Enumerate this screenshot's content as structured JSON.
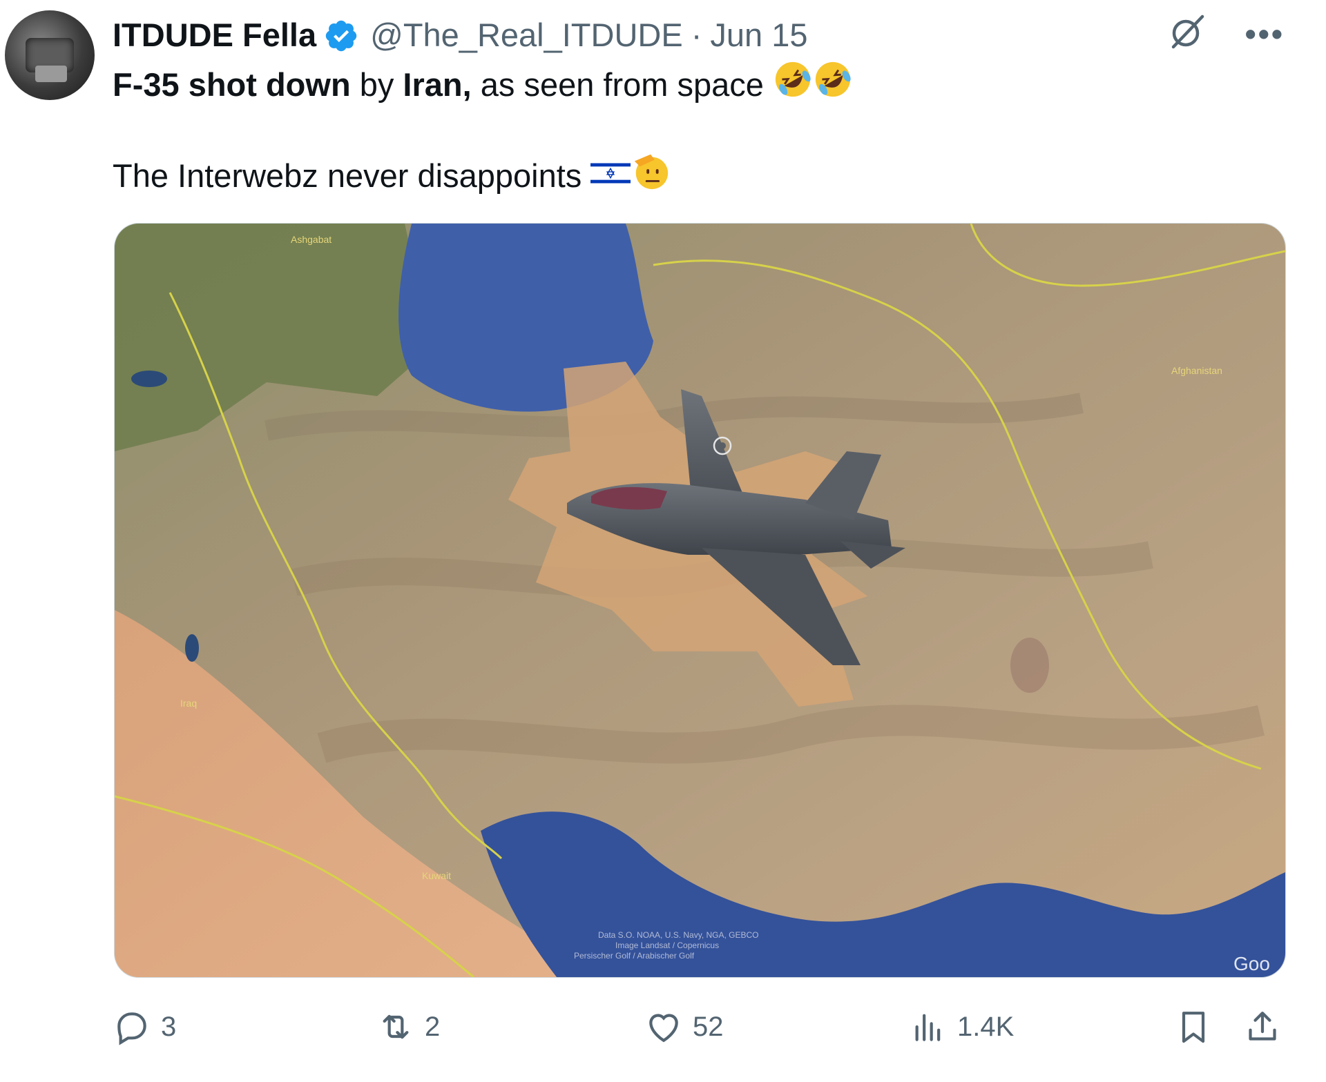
{
  "author": {
    "display_name": "ITDUDE Fella",
    "handle": "@The_Real_ITDUDE",
    "separator": "·",
    "date": "Jun 15"
  },
  "tweet": {
    "line1": {
      "part1_bold": "F-35 shot down",
      "part2": " by ",
      "part3_bold": "Iran,",
      "part4": " as seen from space",
      "emojis": [
        "rolling-on-floor-laughing",
        "rolling-on-floor-laughing"
      ]
    },
    "line2": {
      "text": "The Interwebz never disappoints ",
      "emojis": [
        "israel-flag",
        "saluting-face"
      ]
    }
  },
  "media": {
    "description_icon": "satellite-map-with-f35-image",
    "map_credit": "Data S.O. NOAA, U.S. Navy, NGA, GEBCO",
    "map_credit2": "Image Landsat / Copernicus",
    "map_credit3": "Persischer Golf / Arabischer Golf",
    "map_watermark": "Goo",
    "place_labels": [
      "Ashgabat",
      "Iraq",
      "Kuwait",
      "Afghanistan"
    ]
  },
  "actions": {
    "reply_count": "3",
    "retweet_count": "2",
    "like_count": "52",
    "views_count": "1.4K"
  },
  "icons": {
    "reply": "reply-icon",
    "retweet": "retweet-icon",
    "like": "heart-icon",
    "views": "views-icon",
    "bookmark": "bookmark-icon",
    "share": "share-icon",
    "grok": "grok-icon",
    "more": "more-icon",
    "verified": "verified-badge-icon"
  },
  "colors": {
    "verified_blue": "#1d9bf0",
    "muted": "#536471",
    "text": "#0f1419"
  }
}
